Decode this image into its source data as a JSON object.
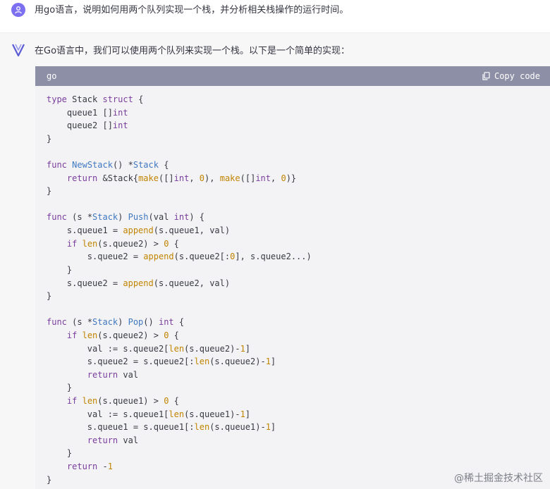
{
  "user_message": {
    "avatar_icon": "user-icon",
    "text": "用go语言，说明如何用两个队列实现一个栈，并分析相关栈操作的运行时间。"
  },
  "assistant_message": {
    "avatar_icon": "assistant-logo-icon",
    "intro": "在Go语言中，我们可以使用两个队列来实现一个栈。以下是一个简单的实现：",
    "code_block": {
      "language": "go",
      "copy_label": "Copy code",
      "copy_icon": "clipboard-icon",
      "lines": [
        "type Stack struct {",
        "    queue1 []int",
        "    queue2 []int",
        "}",
        "",
        "func NewStack() *Stack {",
        "    return &Stack{make([]int, 0), make([]int, 0)}",
        "}",
        "",
        "func (s *Stack) Push(val int) {",
        "    s.queue1 = append(s.queue1, val)",
        "    if len(s.queue2) > 0 {",
        "        s.queue2 = append(s.queue2[:0], s.queue2...)",
        "    }",
        "    s.queue2 = append(s.queue2, val)",
        "}",
        "",
        "func (s *Stack) Pop() int {",
        "    if len(s.queue2) > 0 {",
        "        val := s.queue2[len(s.queue2)-1]",
        "        s.queue2 = s.queue2[:len(s.queue2)-1]",
        "        return val",
        "    }",
        "    if len(s.queue1) > 0 {",
        "        val := s.queue1[len(s.queue1)-1]",
        "        s.queue1 = s.queue1[:len(s.queue1)-1]",
        "        return val",
        "    }",
        "    return -1",
        "}"
      ]
    }
  },
  "watermark": "@稀土掘金技术社区",
  "colors": {
    "user_avatar": "#7c6ff0",
    "code_header": "#8d8fa6",
    "code_background": "#f3f3f6",
    "keyword": "#7a3e9d",
    "function_name": "#4078c0",
    "builtin": "#c18401"
  }
}
